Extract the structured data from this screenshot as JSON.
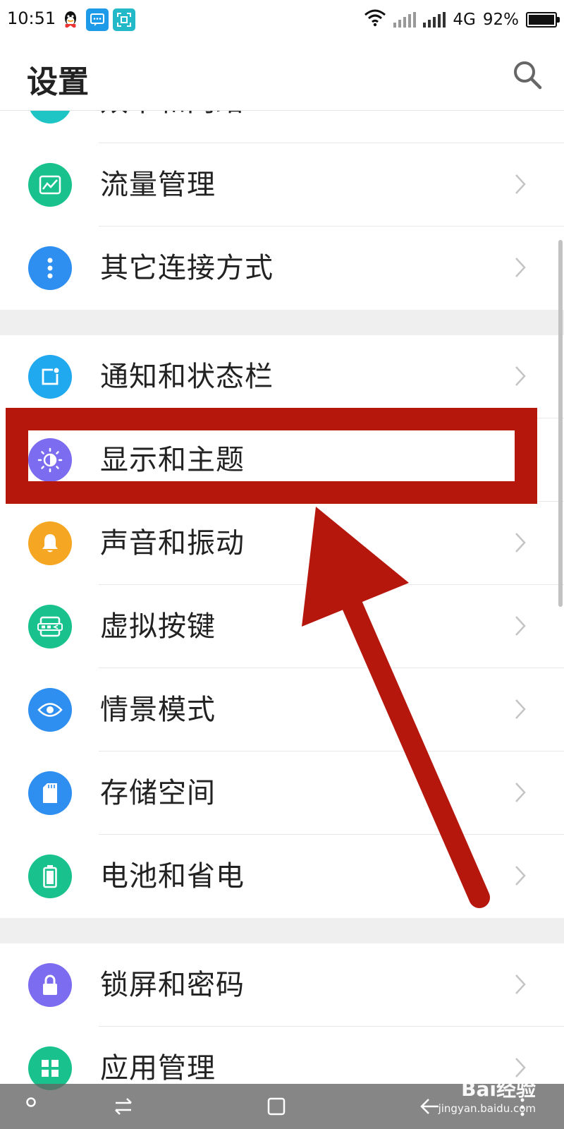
{
  "status_bar": {
    "time": "10:51",
    "network": "4G",
    "battery": "92%",
    "battery_level": 0.92
  },
  "header": {
    "title": "设置",
    "search_icon": "search-icon"
  },
  "list": {
    "partial_item": {
      "label": "双卡和网络",
      "color": "#1fc4c4"
    },
    "group1": [
      {
        "label": "流量管理",
        "icon": "chart-icon",
        "color": "#19c28d"
      },
      {
        "label": "其它连接方式",
        "icon": "more-icon",
        "color": "#2f8ff0"
      }
    ],
    "group2": [
      {
        "label": "通知和状态栏",
        "icon": "notification-icon",
        "color": "#20a9ee"
      },
      {
        "label": "显示和主题",
        "icon": "brightness-icon",
        "color": "#7b6cf0"
      },
      {
        "label": "声音和振动",
        "icon": "bell-icon",
        "color": "#f5a623"
      },
      {
        "label": "虚拟按键",
        "icon": "virtual-keys-icon",
        "color": "#19c28d"
      },
      {
        "label": "情景模式",
        "icon": "eye-icon",
        "color": "#2f8ff0"
      },
      {
        "label": "存储空间",
        "icon": "sd-card-icon",
        "color": "#2f8ff0"
      },
      {
        "label": "电池和省电",
        "icon": "battery-icon",
        "color": "#19c28d"
      }
    ],
    "group3": [
      {
        "label": "锁屏和密码",
        "icon": "lock-icon",
        "color": "#7b6cf0"
      },
      {
        "label": "应用管理",
        "icon": "apps-icon",
        "color": "#19c28d"
      }
    ]
  },
  "annotation": {
    "color": "#b5170d"
  },
  "watermark": {
    "logo": "Bai经验",
    "url": "jingyan.baidu.com"
  }
}
